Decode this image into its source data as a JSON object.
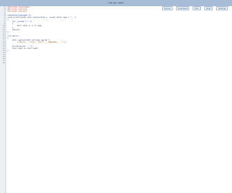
{
  "window": {
    "title": "main.cpp - Editor"
  },
  "toolbar": {
    "buttons": [
      "Source",
      "Download",
      "Run",
      "Help",
      "Settings"
    ]
  },
  "editor": {
    "lines": [
      {
        "n": "1",
        "text": "#include <iostream>",
        "cls": "pp"
      },
      {
        "n": "2",
        "text": "#include <string>",
        "cls": "pp"
      },
      {
        "n": "3",
        "text": "#include <vector>",
        "cls": "pp"
      },
      {
        "n": "4",
        "text": "",
        "cls": ""
      },
      {
        "n": "5",
        "text": "template<typename T>",
        "cls": "kw"
      },
      {
        "n": "6",
        "text": "void print(const std::vector<T>& v, const char* sep = \", \")",
        "cls": ""
      },
      {
        "n": "7",
        "text": "{",
        "cls": ""
      },
      {
        "n": "8",
        "text": "    for (auto& x : v)",
        "cls": "kw"
      },
      {
        "n": "9",
        "text": "    {",
        "cls": ""
      },
      {
        "n": "10",
        "text": "        std::cout << x << sep;",
        "cls": ""
      },
      {
        "n": "11",
        "text": "    }",
        "cls": ""
      },
      {
        "n": "12",
        "text": "    return;",
        "cls": ""
      },
      {
        "n": "13",
        "text": "}",
        "cls": ""
      },
      {
        "n": "14",
        "text": "",
        "cls": ""
      },
      {
        "n": "15",
        "text": "int main()",
        "cls": "kw"
      },
      {
        "n": "16",
        "text": "{",
        "cls": ""
      },
      {
        "n": "17",
        "text": "    std::vector<std::string> words =",
        "cls": ""
      },
      {
        "n": "18",
        "text": "        {\"Hello\", \"from\", \"GCC\", __VERSION__, \"!\"};",
        "cls": "str"
      },
      {
        "n": "19",
        "text": "",
        "cls": ""
      },
      {
        "n": "20",
        "text": "    print(words, \" \");",
        "cls": ""
      },
      {
        "n": "21",
        "text": "    std::cout << std::endl;",
        "cls": ""
      },
      {
        "n": "22",
        "text": "}",
        "cls": ""
      },
      {
        "n": "23",
        "text": "",
        "cls": ""
      },
      {
        "n": "24",
        "text": "",
        "cls": ""
      },
      {
        "n": "25",
        "text": "",
        "cls": ""
      },
      {
        "n": "26",
        "text": "",
        "cls": ""
      },
      {
        "n": "27",
        "text": "",
        "cls": ""
      },
      {
        "n": "28",
        "text": "",
        "cls": ""
      }
    ]
  }
}
